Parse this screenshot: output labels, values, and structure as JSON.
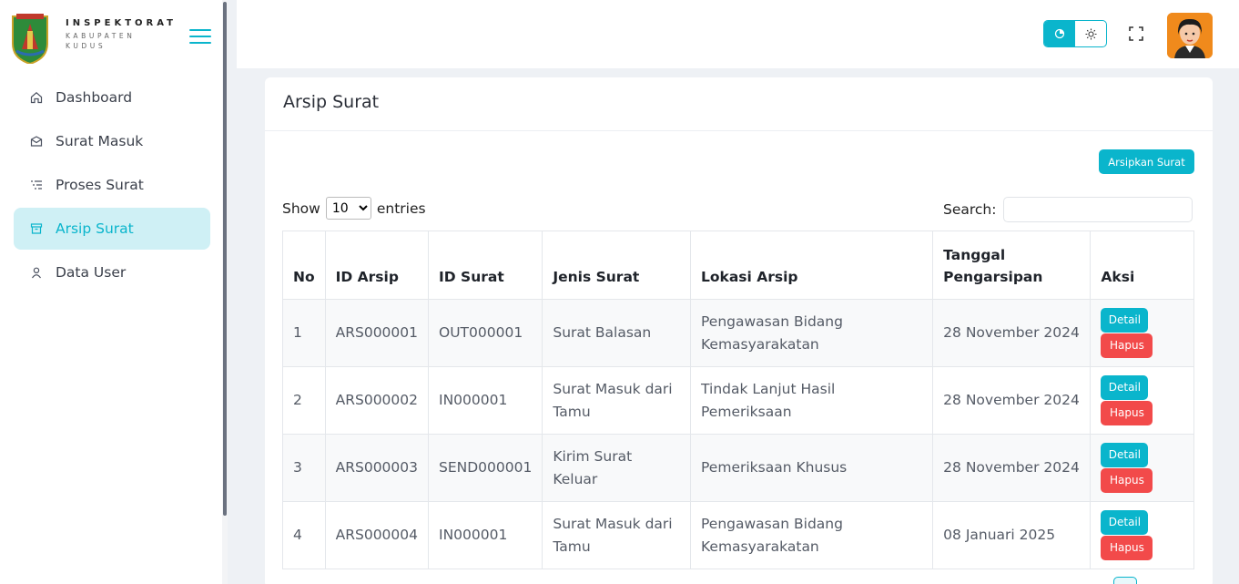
{
  "brand": {
    "title": "INSPEKTORAT",
    "subtitle1": "KABUPATEN",
    "subtitle2": "KUDUS",
    "logo_text": "KUDUS"
  },
  "sidebar": {
    "items": [
      {
        "label": "Dashboard",
        "icon": "home-icon"
      },
      {
        "label": "Surat Masuk",
        "icon": "mailbox-icon"
      },
      {
        "label": "Proses Surat",
        "icon": "list-icon"
      },
      {
        "label": "Arsip Surat",
        "icon": "archive-icon",
        "active": true
      },
      {
        "label": "Data User",
        "icon": "user-icon"
      }
    ]
  },
  "header": {
    "theme_modes": [
      "dark",
      "light"
    ],
    "active_mode": "dark"
  },
  "card": {
    "title": "Arsip Surat",
    "archive_button": "Arsipkan Surat",
    "length": {
      "show": "Show",
      "entries": "entries",
      "selected": "10",
      "options": [
        "10"
      ]
    },
    "search_label": "Search:",
    "search_value": ""
  },
  "table": {
    "headers": [
      "No",
      "ID Arsip",
      "ID Surat",
      "Jenis Surat",
      "Lokasi Arsip",
      "Tanggal Pengarsipan",
      "Aksi"
    ],
    "rows": [
      {
        "no": "1",
        "id_arsip": "ARS000001",
        "id_surat": "OUT000001",
        "jenis": "Surat Balasan",
        "lokasi": "Pengawasan Bidang Kemasyarakatan",
        "tanggal": "28 November 2024"
      },
      {
        "no": "2",
        "id_arsip": "ARS000002",
        "id_surat": "IN000001",
        "jenis": "Surat Masuk dari Tamu",
        "lokasi": "Tindak Lanjut Hasil Pemeriksaan",
        "tanggal": "28 November 2024"
      },
      {
        "no": "3",
        "id_arsip": "ARS000003",
        "id_surat": "SEND000001",
        "jenis": "Kirim Surat Keluar",
        "lokasi": "Pemeriksaan Khusus",
        "tanggal": "28 November 2024"
      },
      {
        "no": "4",
        "id_arsip": "ARS000004",
        "id_surat": "IN000001",
        "jenis": "Surat Masuk dari Tamu",
        "lokasi": "Pengawasan Bidang Kemasyarakatan",
        "tanggal": "08 Januari 2025"
      }
    ],
    "detail_label": "Detail",
    "delete_label": "Hapus"
  },
  "colors": {
    "accent": "#0ab5cc",
    "danger": "#f24a4a",
    "active_bg": "#cff0f5"
  }
}
